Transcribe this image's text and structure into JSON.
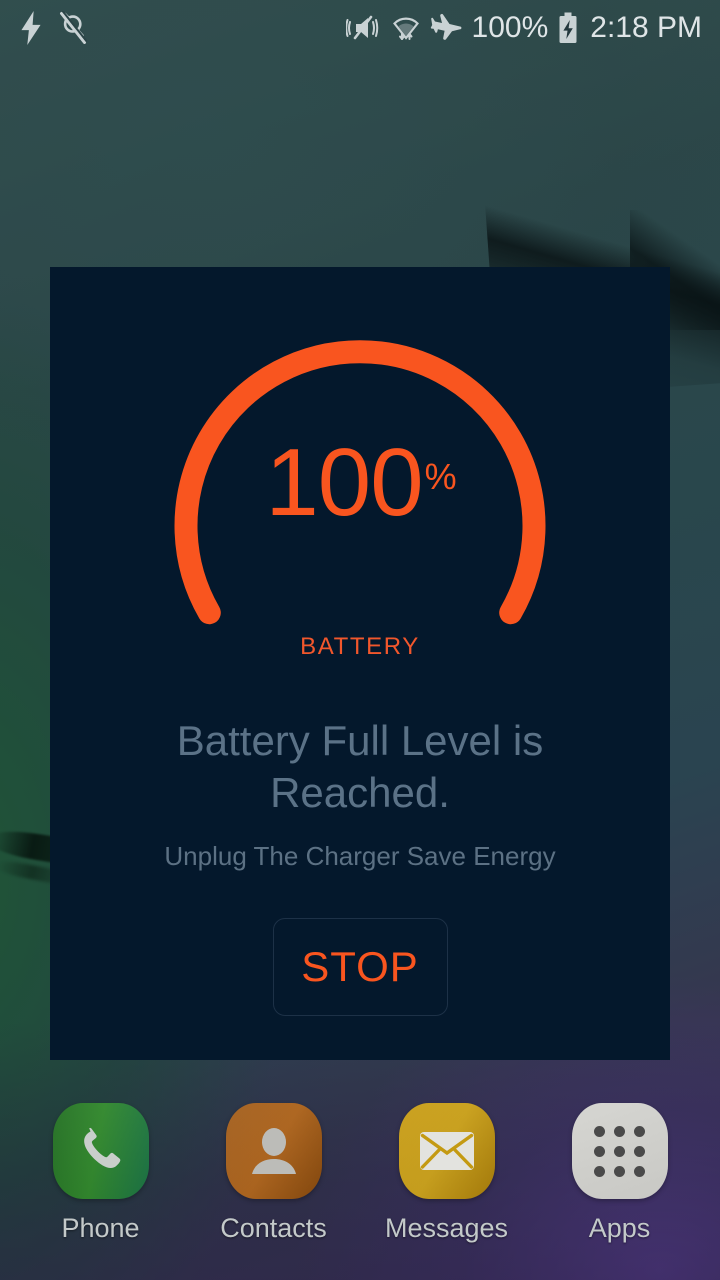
{
  "statusbar": {
    "left_icons": [
      {
        "name": "flash-bolt-icon",
        "glyph": "bolt"
      },
      {
        "name": "plug-off-icon",
        "glyph": "plug-crossed"
      }
    ],
    "right_icons": [
      {
        "name": "vibrate-mute-icon",
        "glyph": "mute-vibrate"
      },
      {
        "name": "wifi-icon",
        "glyph": "wifi"
      },
      {
        "name": "airplane-mode-icon",
        "glyph": "airplane"
      }
    ],
    "battery_percent": "100%",
    "battery_icon": "battery-charging-icon",
    "clock": "2:18 PM"
  },
  "dialog": {
    "gauge": {
      "value": "100",
      "unit": "%",
      "label": "BATTERY",
      "percent": 100,
      "arc_color": "#f9551f",
      "track_color": "#04182c",
      "sweep_degrees": 300,
      "start_angle_degrees": 120
    },
    "title": "Battery Full Level is Reached.",
    "subtitle": "Unplug The Charger Save Energy",
    "stop_label": "STOP",
    "background_color": "#04182c",
    "accent_color": "#f9551f",
    "muted_text_color": "#5b7287"
  },
  "dock": {
    "items": [
      {
        "label": "Phone",
        "icon": "phone-handset-icon",
        "color": "#2f8a2a"
      },
      {
        "label": "Contacts",
        "icon": "contact-person-icon",
        "color": "#b4661a"
      },
      {
        "label": "Messages",
        "icon": "envelope-icon",
        "color": "#d2a618"
      },
      {
        "label": "Apps",
        "icon": "apps-grid-icon",
        "color": "#d6d6d2"
      }
    ]
  }
}
